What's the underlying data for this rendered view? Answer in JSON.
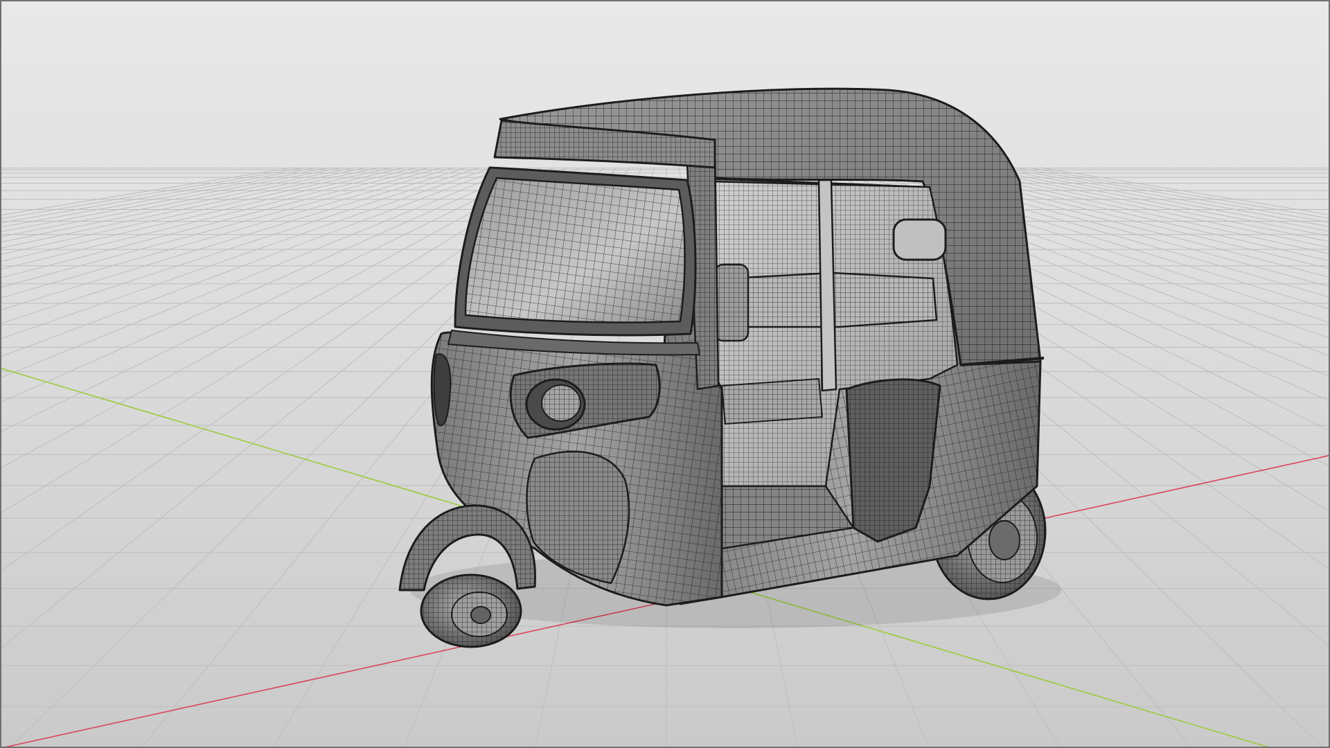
{
  "viewport": {
    "background_top": "#e9e9e9",
    "background_bottom": "#c9c9c9",
    "border_color": "#6f6f6f",
    "grid_color": "#bdbdbd",
    "x_axis_color": "#d9455b",
    "y_axis_color": "#9ccb3c",
    "grid_visible": true,
    "shading": "wireframe-on-solid"
  },
  "model": {
    "subject": "auto-rickshaw",
    "body_color": "#8a8a8a",
    "highlight_color": "#bdbdbd",
    "shadow_color": "#555555",
    "wire_color": "#1c1c1c"
  }
}
